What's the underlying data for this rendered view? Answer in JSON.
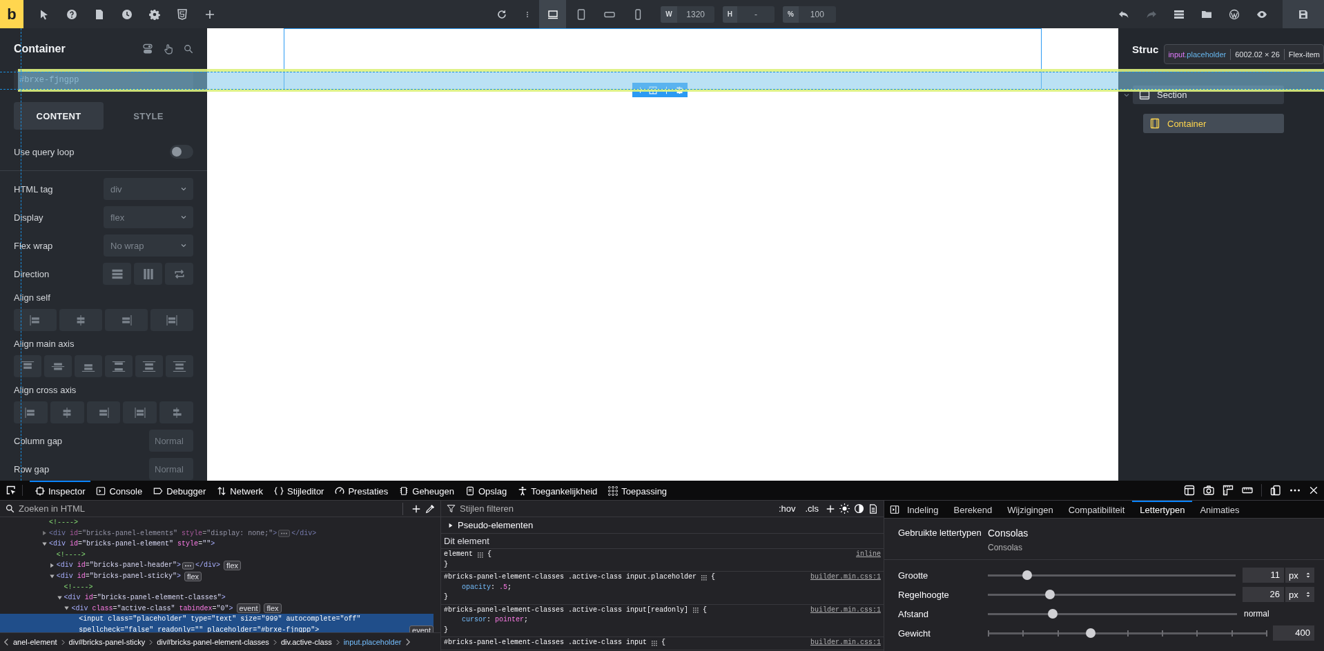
{
  "top_bar": {
    "logo": "b",
    "devices": [
      {
        "kind": "desktop",
        "selected": true
      },
      {
        "kind": "tablet-portrait",
        "selected": false
      },
      {
        "kind": "mobile-landscape",
        "selected": false
      },
      {
        "kind": "mobile-portrait",
        "selected": false
      }
    ],
    "fields": [
      {
        "label": "W",
        "value": "1320"
      },
      {
        "label": "H",
        "value": "-"
      },
      {
        "label": "%",
        "value": "100"
      }
    ]
  },
  "element_panel": {
    "title": "Container",
    "class_placeholder": "#brxe-fjngpp",
    "tabs": [
      {
        "label": "CONTENT",
        "selected": true
      },
      {
        "label": "STYLE",
        "selected": false
      }
    ],
    "query_loop": {
      "label": "Use query loop",
      "on": false
    },
    "controls": [
      {
        "kind": "select",
        "label": "HTML tag",
        "placeholder": "div"
      },
      {
        "kind": "select",
        "label": "Display",
        "placeholder": "flex"
      },
      {
        "kind": "select",
        "label": "Flex wrap",
        "placeholder": "No wrap"
      },
      {
        "kind": "inline-icons",
        "label": "Direction",
        "options": [
          {
            "kind": "row"
          },
          {
            "kind": "column"
          },
          {
            "kind": "reverse"
          }
        ]
      },
      {
        "kind": "icon-group",
        "label": "Align self",
        "options": [
          {
            "kind": "h-start"
          },
          {
            "kind": "h-center"
          },
          {
            "kind": "h-end"
          },
          {
            "kind": "h-stretch"
          }
        ]
      },
      {
        "kind": "icon-group",
        "label": "Align main axis",
        "options": [
          {
            "kind": "v-start"
          },
          {
            "kind": "v-center"
          },
          {
            "kind": "v-end"
          },
          {
            "kind": "v-between"
          },
          {
            "kind": "v-around"
          },
          {
            "kind": "v-evenly"
          }
        ]
      },
      {
        "kind": "icon-group",
        "label": "Align cross axis",
        "options": [
          {
            "kind": "h-start"
          },
          {
            "kind": "h-center"
          },
          {
            "kind": "h-end"
          },
          {
            "kind": "h-stretch"
          },
          {
            "kind": "h-baseline"
          }
        ]
      },
      {
        "kind": "text",
        "label": "Column gap",
        "placeholder": "Normal"
      },
      {
        "kind": "text",
        "label": "Row gap",
        "placeholder": "Normal"
      }
    ]
  },
  "structure": {
    "title": "Struc",
    "items": [
      {
        "label": "Section",
        "expanded": true,
        "selected": false,
        "children": [
          {
            "label": "Container",
            "selected": true
          }
        ]
      }
    ]
  },
  "highlighter": {
    "tag": "input",
    "class": ".placeholder",
    "size": "6002.02 × 26",
    "layout": "Flex-item"
  },
  "devtools": {
    "tabs": [
      {
        "label": "Inspector",
        "kind": "inspector",
        "selected": true
      },
      {
        "label": "Console",
        "kind": "console",
        "selected": false
      },
      {
        "label": "Debugger",
        "kind": "debugger",
        "selected": false
      },
      {
        "label": "Netwerk",
        "kind": "network",
        "selected": false
      },
      {
        "label": "Stijleditor",
        "kind": "style-editor",
        "selected": false
      },
      {
        "label": "Prestaties",
        "kind": "performance",
        "selected": false
      },
      {
        "label": "Geheugen",
        "kind": "memory",
        "selected": false
      },
      {
        "label": "Opslag",
        "kind": "storage",
        "selected": false
      },
      {
        "label": "Toegankelijkheid",
        "kind": "accessibility",
        "selected": false
      },
      {
        "label": "Toepassing",
        "kind": "application",
        "selected": false
      }
    ],
    "html": {
      "search_placeholder": "Zoeken in HTML",
      "tree": [
        {
          "kind": "comment",
          "text": "<!---->",
          "selected": false
        },
        {
          "kind": "element",
          "text": "<div id=\"bricks-panel-elements\" style=\"display: none;\">",
          "collapsed_content": true,
          "closing": "</div>",
          "expanded": false,
          "dimmed": true,
          "selected": false
        },
        {
          "kind": "element",
          "text": "<div id=\"bricks-panel-element\" style=\"\">",
          "expanded": true,
          "dimmed": false,
          "selected": false,
          "children": [
            {
              "kind": "comment",
              "text": "<!---->",
              "selected": false
            },
            {
              "kind": "element",
              "text": "<div id=\"bricks-panel-header\">",
              "collapsed_content": true,
              "closing": "</div>",
              "badges": [
                "flex"
              ],
              "expanded": false,
              "dimmed": false,
              "selected": false
            },
            {
              "kind": "element",
              "text": "<div id=\"bricks-panel-sticky\">",
              "badges": [
                "flex"
              ],
              "expanded": true,
              "dimmed": false,
              "selected": false,
              "children": [
                {
                  "kind": "comment",
                  "text": "<!---->",
                  "selected": false
                },
                {
                  "kind": "element",
                  "text": "<div id=\"bricks-panel-element-classes\">",
                  "expanded": true,
                  "dimmed": false,
                  "selected": false,
                  "children": [
                    {
                      "kind": "element",
                      "text": "<div class=\"active-class\" tabindex=\"0\">",
                      "badges": [
                        "event",
                        "flex"
                      ],
                      "expanded": true,
                      "dimmed": false,
                      "selected": false,
                      "children": [
                        {
                          "kind": "element",
                          "text": "<input class=\"placeholder\" type=\"text\" size=\"999\" autocomplete=\"off\" spellcheck=\"false\" readonly=\"\" placeholder=\"#brxe-fjngpp\">",
                          "badges": [
                            "event"
                          ],
                          "dimmed": false,
                          "selected": true
                        }
                      ]
                    }
                  ]
                }
              ]
            }
          ]
        }
      ],
      "breadcrumbs": [
        {
          "label": "anel-element",
          "selected": false
        },
        {
          "label": "div#bricks-panel-sticky",
          "selected": false
        },
        {
          "label": "div#bricks-panel-element-classes",
          "selected": false
        },
        {
          "label": "div.active-class",
          "selected": false
        },
        {
          "label": "input.placeholder",
          "selected": true
        }
      ]
    },
    "rules": {
      "filter_placeholder": "Stijlen filteren",
      "buttons": [
        ":hov",
        ".cls"
      ],
      "pseudo": {
        "label": "Pseudo-elementen",
        "expanded": false
      },
      "section": "Dit element",
      "rules": [
        {
          "selector": "element",
          "open": "{",
          "source": "inline",
          "close": "}"
        },
        {
          "selector": "#bricks-panel-element-classes .active-class input.placeholder",
          "open": "{",
          "source": "builder.min.css:1",
          "declarations": [
            "opacity: .5;"
          ],
          "close": "}"
        },
        {
          "selector": "#bricks-panel-element-classes .active-class input[readonly]",
          "open": "{",
          "source": "builder.min.css:1",
          "declarations": [
            "cursor: pointer;"
          ],
          "close": "}"
        },
        {
          "selector": "#bricks-panel-element-classes .active-class input",
          "open": "{",
          "source": "builder.min.css:1"
        }
      ]
    },
    "fonts": {
      "tabs": [
        {
          "label": "Indeling",
          "selected": false
        },
        {
          "label": "Berekend",
          "selected": false
        },
        {
          "label": "Wijzigingen",
          "selected": false
        },
        {
          "label": "Compatibiliteit",
          "selected": false
        },
        {
          "label": "Lettertypen",
          "selected": true
        },
        {
          "label": "Animaties",
          "selected": false
        }
      ],
      "used_label": "Gebruikte lettertypen",
      "font_name": "Consolas",
      "font_source": "Consolas",
      "properties": [
        {
          "kind": "slider-unit",
          "label": "Grootte",
          "level": 0.16,
          "value": "11",
          "unit": "px"
        },
        {
          "kind": "slider-unit",
          "label": "Regelhoogte",
          "level": 0.25,
          "value": "26",
          "unit": "px"
        },
        {
          "kind": "slider-reading",
          "label": "Afstand",
          "level": 0.26,
          "reading": "normal"
        },
        {
          "kind": "ticked-slider",
          "label": "Gewicht",
          "level": 0.37,
          "value": "400"
        }
      ]
    }
  }
}
